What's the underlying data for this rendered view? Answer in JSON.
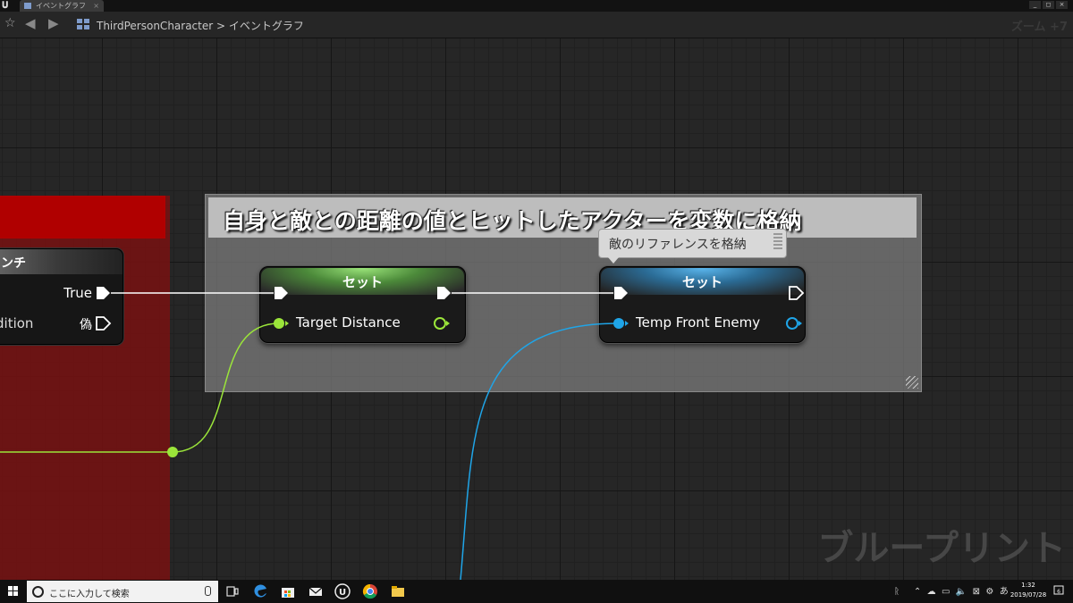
{
  "window": {
    "tab_title": "イベントグラフ",
    "tab_close": "×",
    "buttons": [
      "_",
      "◻",
      "×"
    ]
  },
  "navbar": {
    "breadcrumb_asset": "ThirdPersonCharacter",
    "breadcrumb_sep": ">",
    "breadcrumb_graph": "イベントグラフ",
    "zoom": "ズーム +7"
  },
  "graph": {
    "comment_title": "自身と敵との距離の値とヒットしたアクターを変数に格納",
    "branch_node": {
      "title": "ンチ",
      "true_label": "True",
      "condition_label": "dition",
      "false_label": "偽"
    },
    "set_nodes": [
      {
        "title": "セット",
        "variable": "Target Distance",
        "color": "#9be53a"
      },
      {
        "title": "セット",
        "variable": "Temp Front Enemy",
        "color": "#1fa5e8"
      }
    ],
    "tooltip": "敵のリファレンスを格納",
    "watermark": "ブループリント"
  },
  "taskbar": {
    "search_placeholder": "ここに入力して検索",
    "clock_time": "1:32",
    "clock_date": "2019/07/28",
    "notification_count": "6"
  }
}
